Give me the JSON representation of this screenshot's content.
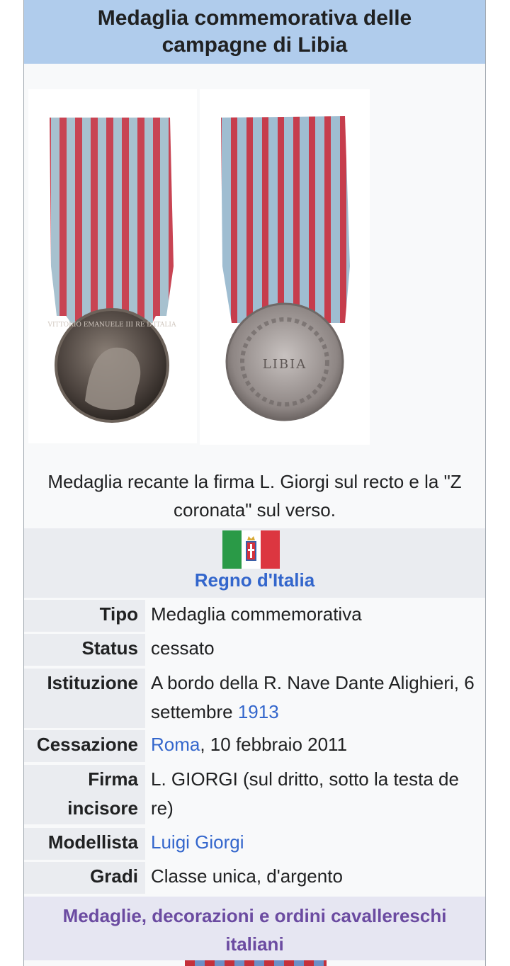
{
  "infobox": {
    "title": "Medaglia commemorativa delle campagne di Libia",
    "caption": "Medaglia recante la firma L. Giorgi sul recto e la \"Z coronata\" sul verso.",
    "obverse_legend": "VITTORIO EMANUELE III RE D'ITALIA",
    "reverse_legend": "LIBIA",
    "state": "Regno d'Italia",
    "rows": [
      {
        "label": "Tipo",
        "value": "Medaglia commemorativa"
      },
      {
        "label": "Status",
        "value": "cessato"
      },
      {
        "label": "Istituzione",
        "value_pre": "A bordo della R. Nave Dante Alighieri, 6 settembre ",
        "value_link": "1913"
      },
      {
        "label": "Cessazione",
        "value_link": "Roma",
        "value_post": ", 10 febbraio 2011"
      },
      {
        "label": "Firma incisore",
        "value": "L. GIORGI (sul dritto, sotto la testa de re)"
      },
      {
        "label": "Modellista",
        "value_link": "Luigi Giorgi"
      },
      {
        "label": "Gradi",
        "value": "Classe unica, d'argento"
      }
    ],
    "footer": "Medaglie, decorazioni e ordini cavallereschi italiani"
  },
  "colors": {
    "header_bg": "#b0ccec",
    "link": "#3366cc",
    "footer_text": "#6b4ba1",
    "ribbon_red": "#c4303a",
    "ribbon_blue": "#9bb8d0"
  }
}
